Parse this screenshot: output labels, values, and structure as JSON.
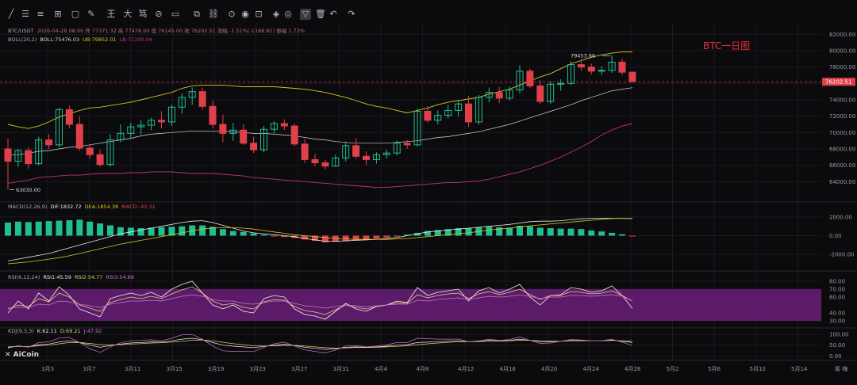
{
  "toolbar": {
    "icons": [
      "line-tool-icon",
      "menu-icon",
      "horizontal-lines-icon",
      "ruler-icon",
      "rectangle-icon",
      "brush-icon",
      "wang-text-icon",
      "da-text-icon",
      "du-text-icon",
      "measure-icon",
      "zoom-icon",
      "copy-icon",
      "link-icon",
      "alert-icon",
      "eye-icon",
      "lock-icon",
      "layers-icon",
      "magnet-icon",
      "filter-icon",
      "delete-icon",
      "undo-icon",
      "redo-icon"
    ],
    "text_icons": {
      "wang": "王",
      "da": "大",
      "du": "笃"
    }
  },
  "legend": {
    "symbol": "BTC/USDT",
    "ohlc": "2026-04-28 08:00  开 77371.32  高 77478.00  低 76145.00  收 76202.51  涨幅 -1.51%(-1168.81)  振幅 1.72%",
    "boll_label": "BOLL(20,2)",
    "boll_mid": "BOLL:75476.03",
    "boll_ub": "UB:79852.01",
    "boll_lb": "LB:71100.04"
  },
  "annotation": {
    "text": "BTC一日图",
    "color": "#e8323c"
  },
  "price_labels": {
    "high": "79453.66",
    "low": "63030.00",
    "current": "76202.51"
  },
  "macd_legend": {
    "name": "MACD(12,26,9)",
    "dif": "DIF:1832.72",
    "dea": "DEA:1854.38",
    "macd": "MACD:-43.31"
  },
  "rsi_legend": {
    "name": "RSI(6,12,24)",
    "rsi1": "RSI1:45.59",
    "rsi2": "RSI2:54.77",
    "rsi3": "RSI3:54.88"
  },
  "kdj_legend": {
    "name": "KDJ(9,3,3)",
    "k": "K:62.11",
    "d": "D:69.21",
    "j": "J:47.92"
  },
  "logo": "AiCoin",
  "corner_label": "筹 嗨",
  "colors": {
    "up": "#1fbf8f",
    "down": "#e0404a",
    "boll_upper": "#d6c51e",
    "boll_mid": "#d8d8d8",
    "boll_lower": "#c0317a",
    "dif": "#e8e8e8",
    "dea": "#d6c51e",
    "rsi_band": "#6a1f7a"
  },
  "chart_data": {
    "type": "candlestick",
    "title": "",
    "ylabel": "",
    "ylim": [
      62000,
      83000
    ],
    "y_ticks": [
      "82000.00",
      "80000.00",
      "78000.00",
      "76000.00",
      "74000.00",
      "72000.00",
      "70000.00",
      "68000.00",
      "66000.00",
      "64000.00"
    ],
    "x_ticks": [
      "3月3",
      "3月7",
      "3月11",
      "3月15",
      "3月19",
      "3月23",
      "3月27",
      "3月31",
      "4月4",
      "4月8",
      "4月12",
      "4月16",
      "4月20",
      "4月24",
      "4月28",
      "5月2",
      "5月6",
      "5月10",
      "5月14"
    ],
    "candles": [
      {
        "o": 68000,
        "h": 69300,
        "l": 63030,
        "c": 66500
      },
      {
        "o": 66500,
        "h": 68000,
        "l": 65800,
        "c": 67800
      },
      {
        "o": 67800,
        "h": 68200,
        "l": 65600,
        "c": 66200
      },
      {
        "o": 66200,
        "h": 69500,
        "l": 66000,
        "c": 69100
      },
      {
        "o": 69100,
        "h": 69800,
        "l": 68000,
        "c": 68500
      },
      {
        "o": 68500,
        "h": 73000,
        "l": 68200,
        "c": 72800
      },
      {
        "o": 72800,
        "h": 73300,
        "l": 70500,
        "c": 71000
      },
      {
        "o": 71000,
        "h": 72000,
        "l": 67800,
        "c": 68100
      },
      {
        "o": 68100,
        "h": 68600,
        "l": 66800,
        "c": 67300
      },
      {
        "o": 67300,
        "h": 67900,
        "l": 65800,
        "c": 66100
      },
      {
        "o": 66100,
        "h": 69800,
        "l": 65800,
        "c": 69100
      },
      {
        "o": 69100,
        "h": 71000,
        "l": 68800,
        "c": 69900
      },
      {
        "o": 69900,
        "h": 71200,
        "l": 69300,
        "c": 70700
      },
      {
        "o": 70700,
        "h": 71500,
        "l": 69800,
        "c": 70900
      },
      {
        "o": 70900,
        "h": 71800,
        "l": 70300,
        "c": 71500
      },
      {
        "o": 71500,
        "h": 72600,
        "l": 70500,
        "c": 71300
      },
      {
        "o": 71300,
        "h": 73400,
        "l": 70800,
        "c": 73100
      },
      {
        "o": 73100,
        "h": 74800,
        "l": 72300,
        "c": 74300
      },
      {
        "o": 74300,
        "h": 75500,
        "l": 73400,
        "c": 75000
      },
      {
        "o": 75000,
        "h": 75500,
        "l": 72800,
        "c": 73200
      },
      {
        "o": 73200,
        "h": 73900,
        "l": 70500,
        "c": 71000
      },
      {
        "o": 71000,
        "h": 72200,
        "l": 68800,
        "c": 69900
      },
      {
        "o": 69900,
        "h": 71200,
        "l": 69000,
        "c": 70300
      },
      {
        "o": 70300,
        "h": 71000,
        "l": 68500,
        "c": 68700
      },
      {
        "o": 68700,
        "h": 69500,
        "l": 67500,
        "c": 67900
      },
      {
        "o": 67900,
        "h": 70800,
        "l": 67600,
        "c": 70400
      },
      {
        "o": 70400,
        "h": 71400,
        "l": 69900,
        "c": 71100
      },
      {
        "o": 71100,
        "h": 71600,
        "l": 70300,
        "c": 70800
      },
      {
        "o": 70800,
        "h": 71100,
        "l": 68300,
        "c": 68600
      },
      {
        "o": 68600,
        "h": 69200,
        "l": 66300,
        "c": 66700
      },
      {
        "o": 66700,
        "h": 67400,
        "l": 65900,
        "c": 66300
      },
      {
        "o": 66300,
        "h": 66700,
        "l": 65500,
        "c": 65900
      },
      {
        "o": 65900,
        "h": 67300,
        "l": 65800,
        "c": 66900
      },
      {
        "o": 66900,
        "h": 68800,
        "l": 66500,
        "c": 68400
      },
      {
        "o": 68400,
        "h": 69300,
        "l": 66800,
        "c": 67100
      },
      {
        "o": 67100,
        "h": 67700,
        "l": 66000,
        "c": 66700
      },
      {
        "o": 66700,
        "h": 67600,
        "l": 66200,
        "c": 67300
      },
      {
        "o": 67300,
        "h": 67900,
        "l": 66800,
        "c": 67500
      },
      {
        "o": 67500,
        "h": 69000,
        "l": 67200,
        "c": 68700
      },
      {
        "o": 68700,
        "h": 69100,
        "l": 68000,
        "c": 68500
      },
      {
        "o": 68500,
        "h": 72900,
        "l": 68300,
        "c": 72600
      },
      {
        "o": 72600,
        "h": 73200,
        "l": 71200,
        "c": 71500
      },
      {
        "o": 71500,
        "h": 72700,
        "l": 71000,
        "c": 72100
      },
      {
        "o": 72100,
        "h": 73400,
        "l": 71700,
        "c": 72700
      },
      {
        "o": 72700,
        "h": 74000,
        "l": 72000,
        "c": 73500
      },
      {
        "o": 73500,
        "h": 74500,
        "l": 70700,
        "c": 71300
      },
      {
        "o": 71300,
        "h": 74600,
        "l": 71000,
        "c": 74300
      },
      {
        "o": 74300,
        "h": 75500,
        "l": 73700,
        "c": 74900
      },
      {
        "o": 74900,
        "h": 75600,
        "l": 73600,
        "c": 74200
      },
      {
        "o": 74200,
        "h": 75600,
        "l": 73900,
        "c": 75200
      },
      {
        "o": 75200,
        "h": 78200,
        "l": 74800,
        "c": 77500
      },
      {
        "o": 77500,
        "h": 77800,
        "l": 75400,
        "c": 75700
      },
      {
        "o": 75700,
        "h": 76400,
        "l": 73500,
        "c": 73800
      },
      {
        "o": 73800,
        "h": 76300,
        "l": 73500,
        "c": 75900
      },
      {
        "o": 75900,
        "h": 76500,
        "l": 75100,
        "c": 76000
      },
      {
        "o": 76000,
        "h": 78700,
        "l": 75800,
        "c": 78300
      },
      {
        "o": 78300,
        "h": 78900,
        "l": 77500,
        "c": 78000
      },
      {
        "o": 78000,
        "h": 78400,
        "l": 77100,
        "c": 77500
      },
      {
        "o": 77500,
        "h": 78100,
        "l": 77000,
        "c": 77600
      },
      {
        "o": 77600,
        "h": 79453.66,
        "l": 77300,
        "c": 78600
      },
      {
        "o": 78600,
        "h": 79000,
        "l": 77000,
        "c": 77371.32
      },
      {
        "o": 77371.32,
        "h": 77478,
        "l": 76145,
        "c": 76202.51
      }
    ],
    "boll_upper": [
      71000,
      70700,
      70500,
      70800,
      71300,
      71900,
      72300,
      72700,
      73000,
      73100,
      73300,
      73500,
      73700,
      74000,
      74300,
      74600,
      74900,
      75400,
      75700,
      75800,
      75800,
      75800,
      75700,
      75600,
      75600,
      75600,
      75600,
      75500,
      75400,
      75300,
      75100,
      74900,
      74600,
      74300,
      73900,
      73500,
      73200,
      73000,
      72700,
      72400,
      72700,
      73000,
      73400,
      73700,
      73900,
      74100,
      74300,
      74700,
      75000,
      75300,
      75800,
      76300,
      76800,
      77200,
      77800,
      78400,
      78800,
      79200,
      79500,
      79700,
      79850,
      79852
    ],
    "boll_mid": [
      67200,
      67300,
      67500,
      67700,
      67800,
      68000,
      68200,
      68300,
      68500,
      68700,
      68900,
      69100,
      69300,
      69600,
      69800,
      69900,
      70000,
      70100,
      70200,
      70200,
      70200,
      70200,
      70100,
      70000,
      69900,
      69900,
      69800,
      69700,
      69600,
      69400,
      69200,
      69100,
      68900,
      68800,
      68700,
      68700,
      68700,
      68700,
      68800,
      68900,
      69000,
      69200,
      69400,
      69500,
      69700,
      69900,
      70100,
      70400,
      70700,
      71000,
      71400,
      71800,
      72200,
      72600,
      73000,
      73400,
      73900,
      74300,
      74700,
      75100,
      75300,
      75476
    ],
    "boll_lower": [
      63800,
      64000,
      64200,
      64500,
      64600,
      64700,
      64800,
      64800,
      64900,
      65000,
      65000,
      65000,
      65100,
      65100,
      65200,
      65200,
      65200,
      65100,
      65000,
      65000,
      65000,
      64900,
      64800,
      64700,
      64500,
      64400,
      64300,
      64200,
      64100,
      64000,
      63900,
      63800,
      63700,
      63600,
      63500,
      63400,
      63300,
      63300,
      63400,
      63500,
      63600,
      63700,
      63800,
      63900,
      63900,
      64000,
      64100,
      64300,
      64600,
      64900,
      65200,
      65600,
      66000,
      66500,
      67000,
      67600,
      68200,
      68900,
      69700,
      70300,
      70800,
      71100
    ],
    "macd": {
      "ylim": [
        -3000,
        3000
      ],
      "y_ticks": [
        "2000.00",
        "0.00",
        "-2000.00"
      ],
      "hist": [
        1400,
        1500,
        1450,
        1500,
        1550,
        1600,
        1650,
        1700,
        1500,
        1300,
        1100,
        900,
        850,
        800,
        850,
        900,
        950,
        1000,
        1100,
        1100,
        950,
        700,
        500,
        400,
        250,
        100,
        -50,
        -150,
        -250,
        -400,
        -550,
        -700,
        -650,
        -600,
        -500,
        -400,
        -300,
        -200,
        -100,
        100,
        300,
        500,
        600,
        700,
        800,
        800,
        900,
        950,
        900,
        850,
        1050,
        1000,
        850,
        800,
        750,
        750,
        700,
        550,
        450,
        300,
        150,
        -43.31
      ],
      "dif": [
        -2700,
        -2500,
        -2300,
        -2100,
        -1900,
        -1600,
        -1300,
        -1000,
        -700,
        -400,
        -100,
        200,
        400,
        600,
        800,
        1000,
        1200,
        1400,
        1550,
        1600,
        1400,
        1100,
        800,
        500,
        300,
        200,
        100,
        0,
        -100,
        -300,
        -450,
        -600,
        -600,
        -550,
        -500,
        -450,
        -400,
        -300,
        -200,
        0,
        200,
        400,
        500,
        600,
        700,
        800,
        900,
        1000,
        1100,
        1200,
        1350,
        1500,
        1550,
        1550,
        1600,
        1700,
        1800,
        1850,
        1850,
        1850,
        1840,
        1832.72
      ],
      "dea": [
        -3000,
        -2900,
        -2800,
        -2650,
        -2500,
        -2350,
        -2150,
        -1900,
        -1650,
        -1400,
        -1150,
        -900,
        -700,
        -500,
        -300,
        -100,
        100,
        300,
        500,
        700,
        800,
        850,
        850,
        800,
        700,
        550,
        400,
        250,
        100,
        0,
        -100,
        -200,
        -300,
        -350,
        -400,
        -400,
        -400,
        -400,
        -350,
        -300,
        -200,
        -100,
        0,
        100,
        200,
        300,
        450,
        600,
        700,
        800,
        950,
        1050,
        1150,
        1250,
        1350,
        1450,
        1550,
        1650,
        1750,
        1820,
        1850,
        1854.38
      ]
    },
    "rsi": {
      "ylim": [
        25,
        85
      ],
      "y_ticks": [
        "80.00",
        "70.00",
        "60.00",
        "40.00",
        "30.00"
      ],
      "band": [
        30,
        70
      ],
      "rsi1": [
        40,
        55,
        45,
        65,
        55,
        73,
        62,
        45,
        40,
        35,
        58,
        62,
        65,
        62,
        66,
        60,
        70,
        76,
        80,
        65,
        50,
        45,
        50,
        42,
        40,
        58,
        62,
        60,
        45,
        38,
        36,
        32,
        42,
        52,
        45,
        42,
        48,
        50,
        55,
        53,
        72,
        62,
        66,
        68,
        70,
        55,
        68,
        72,
        65,
        70,
        76,
        60,
        50,
        62,
        63,
        72,
        70,
        66,
        68,
        74,
        62,
        45.59
      ],
      "rsi2": [
        45,
        50,
        48,
        58,
        54,
        65,
        60,
        50,
        46,
        42,
        53,
        57,
        60,
        58,
        61,
        58,
        64,
        69,
        73,
        65,
        55,
        50,
        52,
        47,
        45,
        54,
        57,
        56,
        48,
        43,
        41,
        38,
        44,
        50,
        47,
        45,
        48,
        50,
        53,
        52,
        63,
        59,
        62,
        64,
        65,
        58,
        64,
        67,
        63,
        66,
        70,
        63,
        57,
        62,
        62,
        67,
        66,
        64,
        65,
        68,
        62,
        54.77
      ],
      "rsi3": [
        46,
        47,
        47,
        51,
        50,
        55,
        54,
        51,
        49,
        47,
        51,
        53,
        55,
        55,
        56,
        55,
        58,
        61,
        63,
        61,
        57,
        55,
        55,
        52,
        51,
        53,
        55,
        55,
        52,
        49,
        48,
        46,
        48,
        50,
        49,
        48,
        49,
        50,
        51,
        51,
        56,
        55,
        57,
        58,
        59,
        57,
        59,
        61,
        60,
        61,
        63,
        61,
        58,
        60,
        60,
        62,
        62,
        61,
        62,
        63,
        61,
        54.88
      ]
    },
    "kdj": {
      "ylim": [
        -10,
        115
      ],
      "y_ticks": [
        "100.00",
        "50.00",
        "0.00"
      ],
      "k": [
        40,
        45,
        42,
        52,
        55,
        65,
        70,
        62,
        50,
        40,
        48,
        55,
        60,
        62,
        65,
        64,
        70,
        78,
        82,
        75,
        62,
        50,
        45,
        42,
        38,
        44,
        50,
        54,
        48,
        40,
        35,
        30,
        33,
        40,
        42,
        40,
        42,
        45,
        50,
        52,
        62,
        64,
        66,
        68,
        70,
        66,
        68,
        72,
        70,
        72,
        78,
        72,
        66,
        66,
        68,
        72,
        72,
        70,
        70,
        74,
        68,
        62.11
      ],
      "d": [
        42,
        44,
        43,
        47,
        50,
        56,
        62,
        62,
        58,
        52,
        51,
        52,
        55,
        57,
        60,
        61,
        64,
        68,
        73,
        74,
        70,
        63,
        57,
        52,
        47,
        46,
        47,
        49,
        49,
        46,
        42,
        38,
        36,
        37,
        39,
        39,
        40,
        42,
        44,
        47,
        52,
        56,
        60,
        63,
        66,
        66,
        67,
        69,
        69,
        70,
        73,
        72,
        70,
        69,
        68,
        70,
        71,
        70,
        70,
        72,
        70,
        69.21
      ],
      "j": [
        36,
        47,
        40,
        62,
        65,
        83,
        86,
        62,
        34,
        16,
        42,
        61,
        70,
        72,
        75,
        70,
        82,
        98,
        100,
        77,
        46,
        24,
        21,
        22,
        20,
        40,
        56,
        64,
        46,
        28,
        21,
        14,
        27,
        46,
        48,
        42,
        46,
        51,
        62,
        62,
        82,
        80,
        78,
        78,
        78,
        66,
        70,
        78,
        72,
        76,
        88,
        72,
        58,
        60,
        68,
        76,
        74,
        70,
        70,
        78,
        64,
        47.92
      ]
    }
  }
}
